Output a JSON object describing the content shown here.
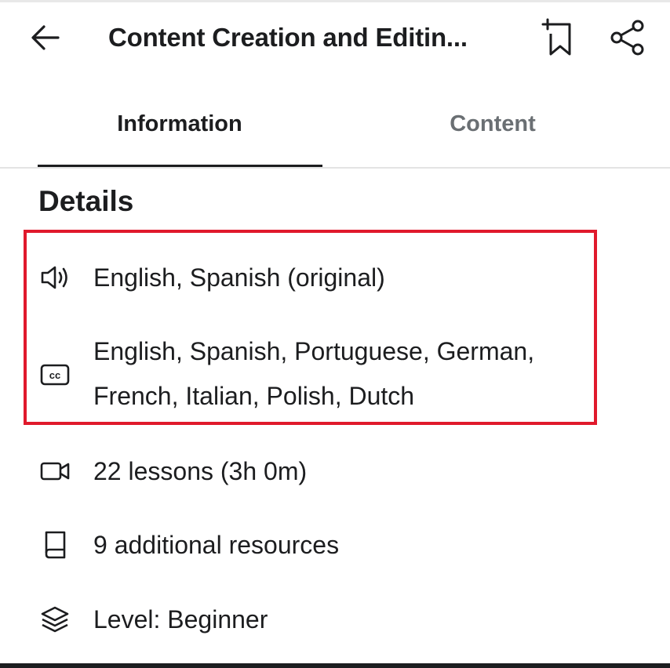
{
  "header": {
    "title": "Content Creation and Editin...",
    "back_icon": "arrow-left-icon",
    "bookmark_icon": "bookmark-add-icon",
    "share_icon": "share-icon"
  },
  "tabs": [
    {
      "label": "Information",
      "active": true
    },
    {
      "label": "Content",
      "active": false
    }
  ],
  "details": {
    "title": "Details",
    "items": [
      {
        "icon": "speaker-icon",
        "text": "English, Spanish (original)"
      },
      {
        "icon": "closed-captions-icon",
        "text_line1": "English, Spanish, Portuguese, German,",
        "text_line2": "French, Italian, Polish, Dutch"
      },
      {
        "icon": "video-camera-icon",
        "text": "22 lessons (3h 0m)"
      },
      {
        "icon": "book-icon",
        "text": "9 additional resources"
      },
      {
        "icon": "layers-icon",
        "text": "Level: Beginner"
      }
    ]
  },
  "colors": {
    "text": "#1c1d1f",
    "muted": "#6a6f73",
    "highlight": "#e0192c"
  }
}
